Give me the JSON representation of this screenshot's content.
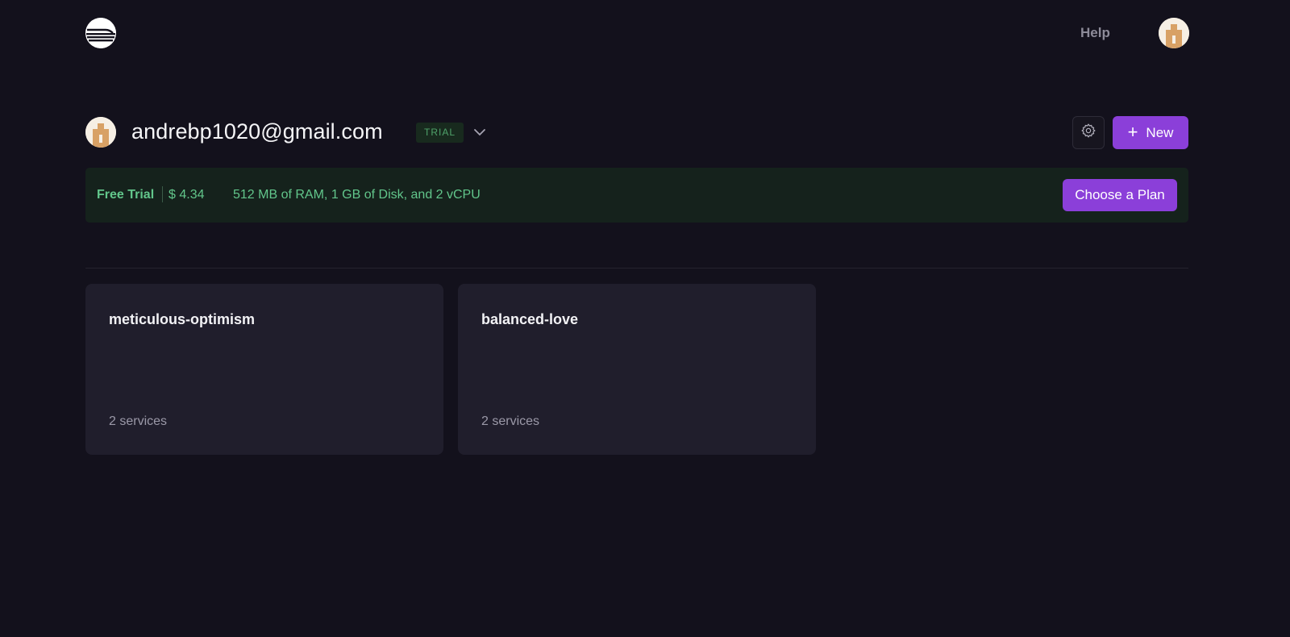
{
  "header": {
    "logo_icon": "railway-logo-icon",
    "help_label": "Help",
    "avatar_icon": "user-avatar-icon"
  },
  "account": {
    "email": "andrebp1020@gmail.com",
    "badge": "TRIAL",
    "dropdown_icon": "chevron-down-icon",
    "settings_icon": "gear-icon",
    "new_label": "New",
    "new_icon": "plus-icon"
  },
  "trial_banner": {
    "title": "Free Trial",
    "balance": "$ 4.34",
    "resources": "512 MB of RAM, 1 GB of Disk, and 2 vCPU",
    "cta_label": "Choose a Plan"
  },
  "projects": [
    {
      "name": "meticulous-optimism",
      "services": "2 services"
    },
    {
      "name": "balanced-love",
      "services": "2 services"
    }
  ],
  "colors": {
    "background": "#13111c",
    "accent": "#8b3fd9",
    "card": "#201e2c",
    "trial_green": "#62c68b",
    "banner_bg": "#15221c"
  }
}
